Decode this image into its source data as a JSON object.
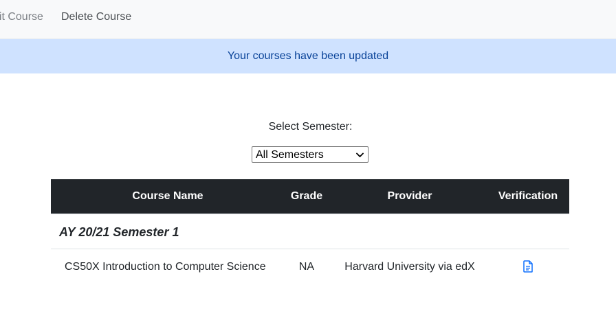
{
  "nav": {
    "items": [
      {
        "label": "dit Course"
      },
      {
        "label": "Delete Course"
      }
    ]
  },
  "alert": {
    "message": "Your courses have been updated"
  },
  "semester_select": {
    "label": "Select Semester:",
    "selected": "All Semesters"
  },
  "table": {
    "headers": [
      "Course Name",
      "Grade",
      "Provider",
      "Verification"
    ],
    "groups": [
      {
        "label": "AY 20/21 Semester 1",
        "rows": [
          {
            "course_name": "CS50X Introduction to Computer Science",
            "grade": "NA",
            "provider": "Harvard University via edX",
            "verification_icon": "document-icon"
          }
        ]
      }
    ]
  },
  "colors": {
    "nav_bg": "#f8f9fa",
    "alert_bg": "#cfe2ff",
    "alert_text": "#084298",
    "table_head_bg": "#212529",
    "icon_blue": "#0d6efd"
  }
}
